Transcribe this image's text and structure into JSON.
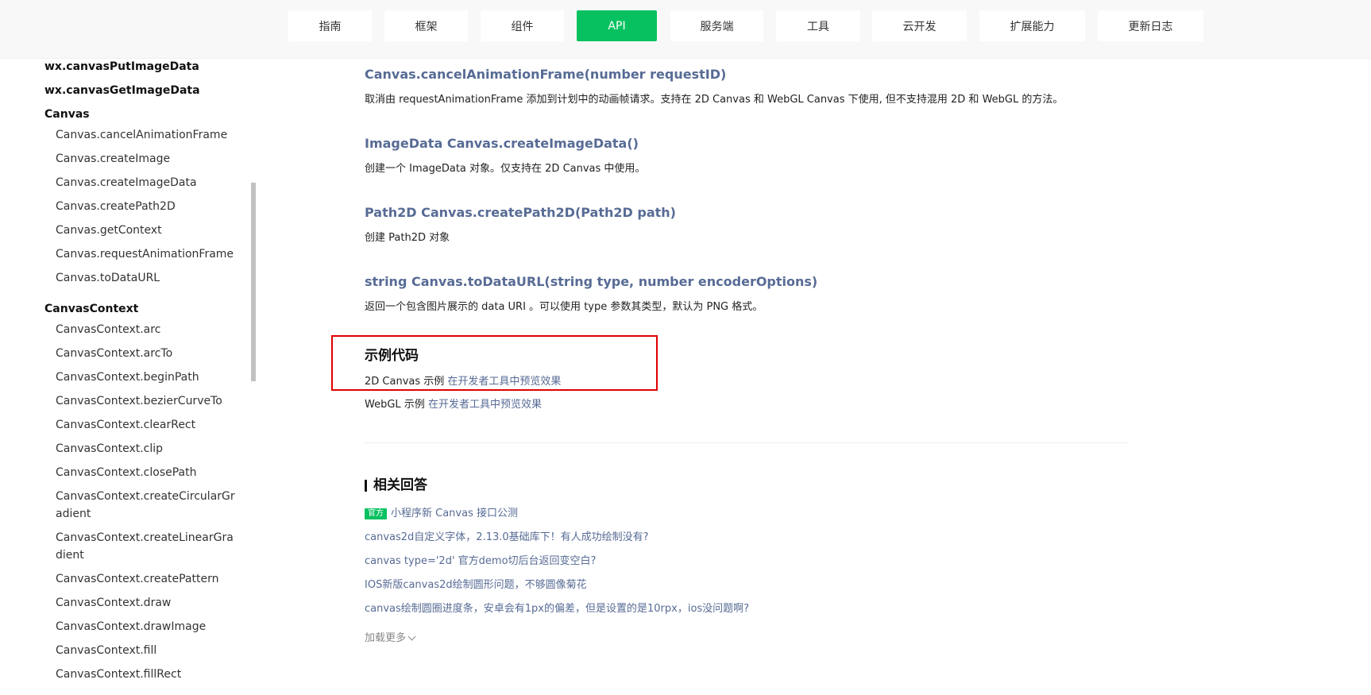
{
  "nav": {
    "items": [
      {
        "label": "指南"
      },
      {
        "label": "框架"
      },
      {
        "label": "组件"
      },
      {
        "label": "API",
        "active": true
      },
      {
        "label": "服务端"
      },
      {
        "label": "工具"
      },
      {
        "label": "云开发"
      },
      {
        "label": "扩展能力"
      },
      {
        "label": "更新日志"
      }
    ]
  },
  "sidebar": {
    "top_items": [
      "wx.canvasPutImageData",
      "wx.canvasGetImageData"
    ],
    "canvas_heading": "Canvas",
    "canvas_items": [
      "Canvas.cancelAnimationFrame",
      "Canvas.createImage",
      "Canvas.createImageData",
      "Canvas.createPath2D",
      "Canvas.getContext",
      "Canvas.requestAnimationFrame",
      "Canvas.toDataURL"
    ],
    "context_heading": "CanvasContext",
    "context_items": [
      "CanvasContext.arc",
      "CanvasContext.arcTo",
      "CanvasContext.beginPath",
      "CanvasContext.bezierCurveTo",
      "CanvasContext.clearRect",
      "CanvasContext.clip",
      "CanvasContext.closePath",
      "CanvasContext.createCircularGr",
      "adient",
      "CanvasContext.createLinearGra",
      "dient",
      "CanvasContext.createPattern",
      "CanvasContext.draw",
      "CanvasContext.drawImage",
      "CanvasContext.fill",
      "CanvasContext.fillRect"
    ]
  },
  "main": {
    "apis": [
      {
        "title": "Canvas.cancelAnimationFrame(number requestID)",
        "desc": "取消由 requestAnimationFrame 添加到计划中的动画帧请求。支持在 2D Canvas 和 WebGL Canvas 下使用, 但不支持混用 2D 和 WebGL 的方法。"
      },
      {
        "title": "ImageData Canvas.createImageData()",
        "desc": "创建一个 ImageData 对象。仅支持在 2D Canvas 中使用。"
      },
      {
        "title": "Path2D Canvas.createPath2D(Path2D path)",
        "desc": "创建 Path2D 对象"
      },
      {
        "title": "string Canvas.toDataURL(string type, number encoderOptions)",
        "desc": "返回一个包含图片展示的 data URI 。可以使用 type 参数其类型，默认为 PNG 格式。"
      }
    ],
    "example": {
      "title": "示例代码",
      "line1_prefix": "2D Canvas 示例 ",
      "line1_link": "在开发者工具中预览效果",
      "line2_prefix": "WebGL 示例 ",
      "line2_link": "在开发者工具中预览效果"
    },
    "related": {
      "title": "相关回答",
      "badge": "官方",
      "items": [
        "小程序新 Canvas 接口公测",
        "canvas2d自定义字体，2.13.0基础库下！有人成功绘制没有?",
        "canvas type='2d' 官方demo切后台返回变空白?",
        "IOS新版canvas2d绘制圆形问题，不够圆像菊花",
        "canvas绘制圆圈进度条，安卓会有1px的偏差，但是设置的是10rpx，ios没问题啊?"
      ],
      "load_more": "加载更多"
    }
  },
  "colors": {
    "accent": "#07c160",
    "link": "#576b95",
    "highlight": "#e00000"
  }
}
